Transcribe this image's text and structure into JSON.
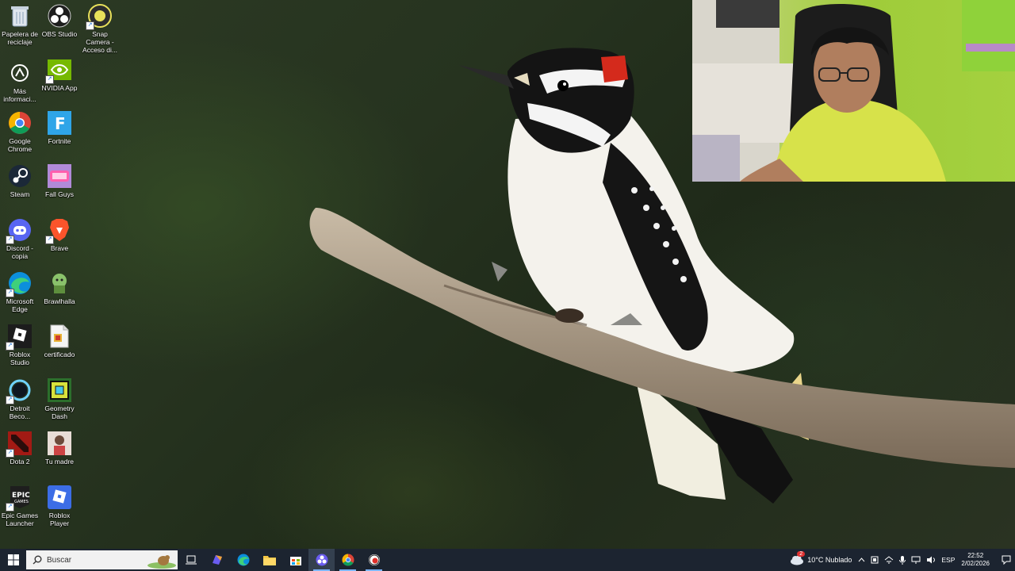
{
  "desktop": {
    "icons": [
      {
        "label": "Papelera de reciclaje",
        "icon": "recycle-bin-icon"
      },
      {
        "label": "OBS Studio",
        "icon": "obs-icon"
      },
      {
        "label": "Snap Camera - Acceso di...",
        "icon": "snap-camera-icon"
      },
      {
        "label": "Más informaci...",
        "icon": "info-icon"
      },
      {
        "label": "NVIDIA App",
        "icon": "nvidia-icon"
      },
      {
        "label": "Google Chrome",
        "icon": "chrome-icon"
      },
      {
        "label": "Fortnite",
        "icon": "fortnite-icon"
      },
      {
        "label": "Steam",
        "icon": "steam-icon"
      },
      {
        "label": "Fall Guys",
        "icon": "fall-guys-icon"
      },
      {
        "label": "Discord - copia",
        "icon": "discord-icon"
      },
      {
        "label": "Brave",
        "icon": "brave-icon"
      },
      {
        "label": "Microsoft Edge",
        "icon": "edge-icon"
      },
      {
        "label": "Brawlhalla",
        "icon": "brawlhalla-icon"
      },
      {
        "label": "Roblox Studio",
        "icon": "roblox-studio-icon"
      },
      {
        "label": "certificado",
        "icon": "document-icon"
      },
      {
        "label": "Detroit Beco...",
        "icon": "detroit-icon"
      },
      {
        "label": "Geometry Dash",
        "icon": "geometry-dash-icon"
      },
      {
        "label": "Dota 2",
        "icon": "dota-icon"
      },
      {
        "label": "Tu madre",
        "icon": "image-file-icon"
      },
      {
        "label": "Epic Games Launcher",
        "icon": "epic-games-icon"
      },
      {
        "label": "Roblox Player",
        "icon": "roblox-player-icon"
      }
    ]
  },
  "taskbar": {
    "search_placeholder": "Buscar",
    "weather": "10°C  Nublado",
    "language": "ESP",
    "time": "22:52",
    "date": "2/02/2026",
    "weather_badge": "2",
    "accent": "#7cb6ff"
  }
}
